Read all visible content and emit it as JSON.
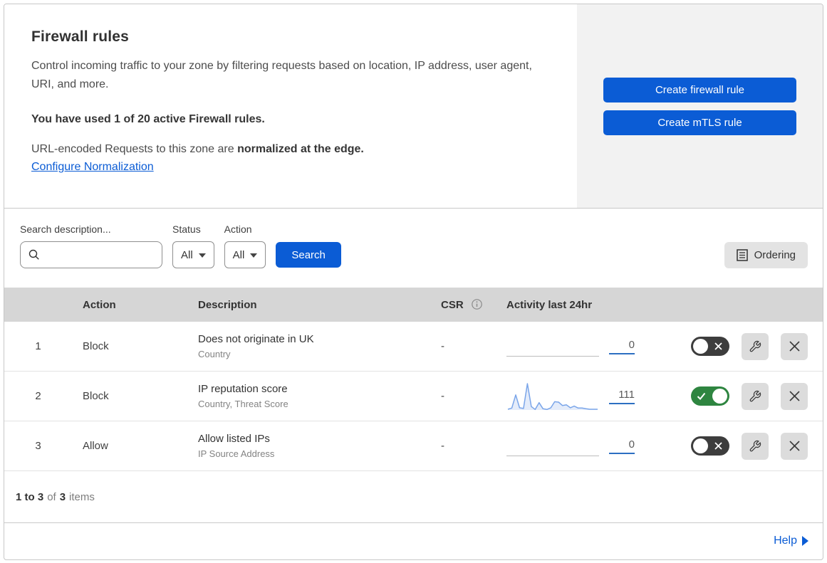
{
  "header": {
    "title": "Firewall rules",
    "description": "Control incoming traffic to your zone by filtering requests based on location, IP address, user agent, URI, and more.",
    "usage_note": "You have used 1 of 20 active Firewall rules.",
    "normalization_prefix": "URL-encoded Requests to this zone are ",
    "normalization_bold": "normalized at the edge.",
    "normalization_link": "Configure Normalization",
    "create_firewall_rule_button": "Create firewall rule",
    "create_mtls_rule_button": "Create mTLS rule"
  },
  "filters": {
    "search_label": "Search description...",
    "search_value": "",
    "status_label": "Status",
    "status_value": "All",
    "action_label": "Action",
    "action_value": "All",
    "search_button": "Search",
    "ordering_button": "Ordering"
  },
  "table": {
    "columns": {
      "action": "Action",
      "description": "Description",
      "csr": "CSR",
      "activity": "Activity last 24hr"
    },
    "rows": [
      {
        "priority": "1",
        "action": "Block",
        "description": "Does not originate in UK",
        "fields": "Country",
        "csr": "-",
        "activity_count": "0",
        "enabled": false,
        "sparkline": []
      },
      {
        "priority": "2",
        "action": "Block",
        "description": "IP reputation score",
        "fields": "Country, Threat Score",
        "csr": "-",
        "activity_count": "111",
        "enabled": true,
        "sparkline": [
          3,
          8,
          62,
          9,
          6,
          108,
          14,
          2,
          30,
          5,
          2,
          9,
          34,
          32,
          18,
          21,
          9,
          16,
          8,
          8,
          5,
          3,
          3,
          3
        ]
      },
      {
        "priority": "3",
        "action": "Allow",
        "description": "Allow listed IPs",
        "fields": "IP Source Address",
        "csr": "-",
        "activity_count": "0",
        "enabled": false,
        "sparkline": []
      }
    ]
  },
  "footer": {
    "range": "1 to 3",
    "of_word": "of",
    "total": "3",
    "items_word": "items"
  },
  "help": {
    "label": "Help"
  },
  "colors": {
    "primary_blue": "#0b5cd5",
    "toggle_on_green": "#2e8540",
    "toggle_off_gray": "#3d3d3d",
    "sparkline_line": "#7aa5e9",
    "sparkline_fill": "#dfe9f9",
    "table_header_bg": "#d6d6d6",
    "panel_gray": "#f2f2f2"
  }
}
